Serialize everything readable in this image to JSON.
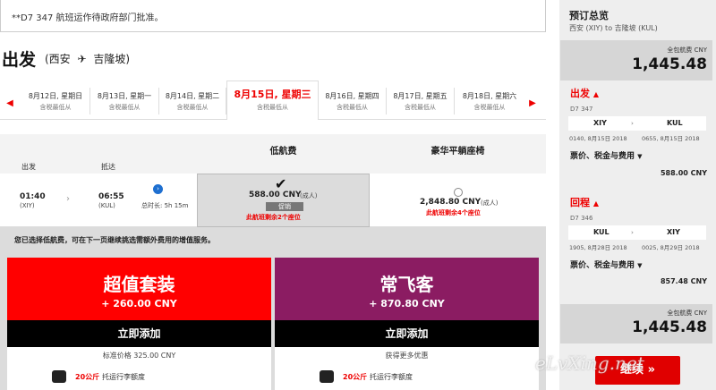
{
  "notice": "**D7 347 航班运作待政府部门批准。",
  "header": {
    "title": "出发",
    "route_from": "(西安",
    "route_arrow": "✈",
    "route_to": "吉隆坡)"
  },
  "dates": [
    {
      "date": "8月12日, 星期日",
      "sub": "含税最低从"
    },
    {
      "date": "8月13日, 星期一",
      "sub": "含税最低从"
    },
    {
      "date": "8月14日, 星期二",
      "sub": "含税最低从"
    },
    {
      "date": "8月15日, 星期三",
      "sub": "含税最低从"
    },
    {
      "date": "8月16日, 星期四",
      "sub": "含税最低从"
    },
    {
      "date": "8月17日, 星期五",
      "sub": "含税最低从"
    },
    {
      "date": "8月18日, 星期六",
      "sub": "含税最低从"
    }
  ],
  "fare_columns": {
    "low": "低航费",
    "premium": "豪华平躺座椅"
  },
  "flight": {
    "depart_label": "出发",
    "arrive_label": "抵达",
    "depart_time": "01:40",
    "depart_code": "(XIY)",
    "arrive_time": "06:55",
    "arrive_code": "(KUL)",
    "duration": "总时长: 5h 15m",
    "low_price": "588.00 CNY",
    "low_suffix": "(成人)",
    "promo": "促销",
    "low_remaining": "此航班剩余2个座位",
    "premium_price": "2,848.80 CNY",
    "premium_suffix": "(成人)",
    "premium_remaining": "此航班剩余4个座位"
  },
  "selected_msg": "您已选择低航费，可在下一页继续挑选需额外费用的增值服务。",
  "bundles": [
    {
      "name": "超值套装",
      "price": "+ 260.00 CNY",
      "add": "立即添加",
      "note": "标准价格 325.00 CNY",
      "baggage_kg": "20公斤",
      "baggage": "托运行李额度"
    },
    {
      "name": "常飞客",
      "price": "+ 870.80 CNY",
      "add": "立即添加",
      "note": "获得更多优惠",
      "baggage_kg": "20公斤",
      "baggage": "托运行李额度"
    }
  ],
  "summary": {
    "title": "预订总览",
    "subtitle": "西安 (XIY) to 吉隆坡 (KUL)",
    "total_label": "全包航费 CNY",
    "total": "1,445.48",
    "outbound": {
      "label": "出发",
      "flight": "D7 347",
      "from": "XIY",
      "to": "KUL",
      "dep": "0140, 8月15日 2018",
      "arr": "0655, 8月15日 2018",
      "fees_label": "票价、税金与费用",
      "amount": "588.00 CNY"
    },
    "inbound": {
      "label": "回程",
      "flight": "D7 346",
      "from": "KUL",
      "to": "XIY",
      "dep": "1905, 8月28日 2018",
      "arr": "0025, 8月29日 2018",
      "fees_label": "票价、税金与费用",
      "amount": "857.48 CNY"
    },
    "total2_label": "全包航费 CNY",
    "total2": "1,445.48",
    "continue": "继续"
  },
  "watermark": "eLvXing.net",
  "colors": {
    "accent": "#e00000",
    "promo_red": "#ff0000",
    "purple": "#8b1c62"
  }
}
